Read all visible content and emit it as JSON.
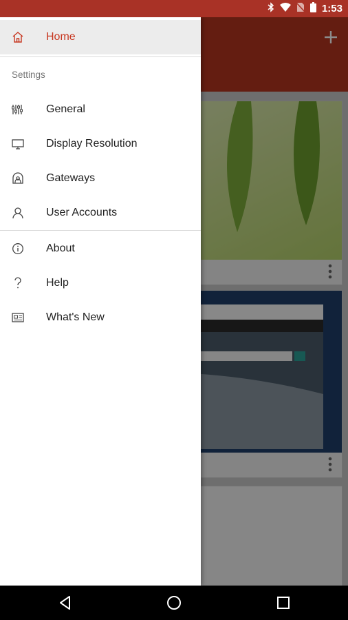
{
  "status_bar": {
    "time": "1:53",
    "icons": [
      "bluetooth-icon",
      "wifi-icon",
      "no-sim-icon",
      "battery-icon"
    ],
    "background_color": "#a93226"
  },
  "drawer": {
    "home": {
      "label": "Home",
      "icon": "home-icon"
    },
    "section_label": "Settings",
    "settings_items": [
      {
        "label": "General",
        "icon": "sliders-icon"
      },
      {
        "label": "Display Resolution",
        "icon": "monitor-icon"
      },
      {
        "label": "Gateways",
        "icon": "gateway-icon"
      },
      {
        "label": "User Accounts",
        "icon": "user-icon"
      }
    ],
    "info_items": [
      {
        "label": "About",
        "icon": "info-icon"
      },
      {
        "label": "Help",
        "icon": "question-icon"
      },
      {
        "label": "What's New",
        "icon": "news-icon"
      }
    ],
    "accent_color": "#c7361f"
  },
  "background_app": {
    "header_color": "#b7361f",
    "add_button": "plus-icon",
    "tiles": [
      "desktop-thumbnail-leaves",
      "desktop-thumbnail-browser",
      "desktop-thumbnail-empty"
    ]
  },
  "nav_bar": {
    "buttons": [
      "back-icon",
      "home-circle-icon",
      "recents-icon"
    ]
  }
}
